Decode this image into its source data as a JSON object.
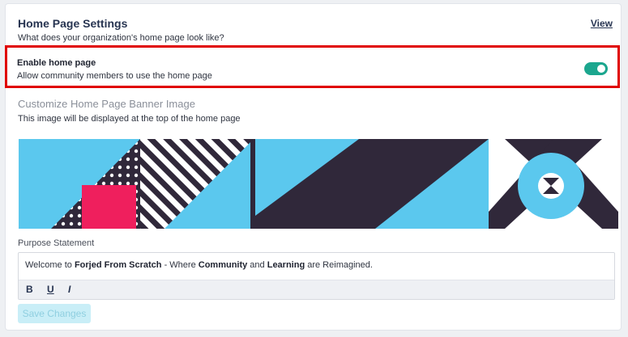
{
  "header": {
    "title": "Home Page Settings",
    "view_link": "View",
    "subtitle": "What does your organization's home page look like?"
  },
  "enable_home_page": {
    "title": "Enable home page",
    "description": "Allow community members to use the home page",
    "enabled": true,
    "toggle_color": "#1ba68e"
  },
  "banner": {
    "title": "Customize Home Page Banner Image",
    "description": "This image will be displayed at the top of the home page",
    "colors": {
      "blue": "#5bc8ee",
      "dark": "#30283a",
      "pink": "#ef1f5d"
    }
  },
  "purpose": {
    "label": "Purpose Statement",
    "segments": [
      {
        "text": "Welcome to ",
        "bold": false
      },
      {
        "text": "Forjed From Scratch",
        "bold": true
      },
      {
        "text": " - Where ",
        "bold": false
      },
      {
        "text": "Community",
        "bold": true
      },
      {
        "text": " and ",
        "bold": false
      },
      {
        "text": "Learning",
        "bold": true
      },
      {
        "text": " are Reimagined.",
        "bold": false
      }
    ],
    "toolbar": {
      "bold": "B",
      "underline": "U",
      "italic": "I"
    }
  },
  "actions": {
    "save_label": "Save Changes"
  },
  "accent": {
    "highlight_border": "#e00000"
  }
}
